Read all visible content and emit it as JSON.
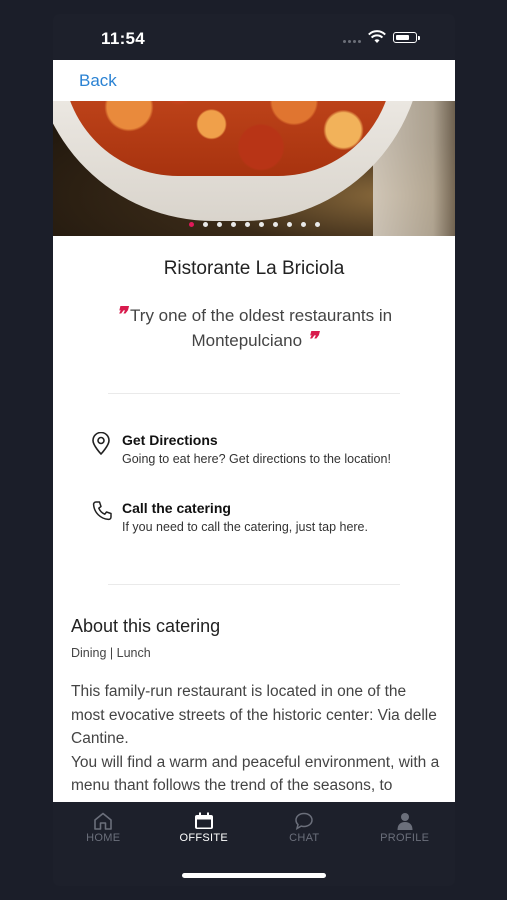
{
  "status": {
    "time": "11:54"
  },
  "nav": {
    "back_label": "Back"
  },
  "carousel": {
    "dot_count": 10,
    "active_index": 0
  },
  "restaurant": {
    "name": "Ristorante La Briciola",
    "quote": "Try one of the oldest restaurants in Montepulciano"
  },
  "actions": [
    {
      "title": "Get Directions",
      "subtitle": "Going to eat here? Get directions to the location!",
      "icon": "map-pin-icon"
    },
    {
      "title": "Call the catering",
      "subtitle": "If you need to call the catering, just tap here.",
      "icon": "phone-icon"
    }
  ],
  "about": {
    "title": "About this catering",
    "tags": "Dining | Lunch",
    "description": "This family-run restaurant is located in one of the most evocative streets of the historic center: Via delle Cantine.\nYou will find a warm and peaceful environment, with a menu thant follows the trend of the seasons, to always ensure seasonal foods and proposals"
  },
  "tabs": [
    {
      "label": "HOME",
      "icon": "home-icon",
      "active": false
    },
    {
      "label": "OFFSITE",
      "icon": "calendar-icon",
      "active": true
    },
    {
      "label": "CHAT",
      "icon": "chat-bubble-icon",
      "active": false
    },
    {
      "label": "PROFILE",
      "icon": "profile-icon",
      "active": false
    }
  ],
  "colors": {
    "accent": "#e0195a",
    "link": "#2a82d3",
    "tabbar": "#1d202b"
  }
}
